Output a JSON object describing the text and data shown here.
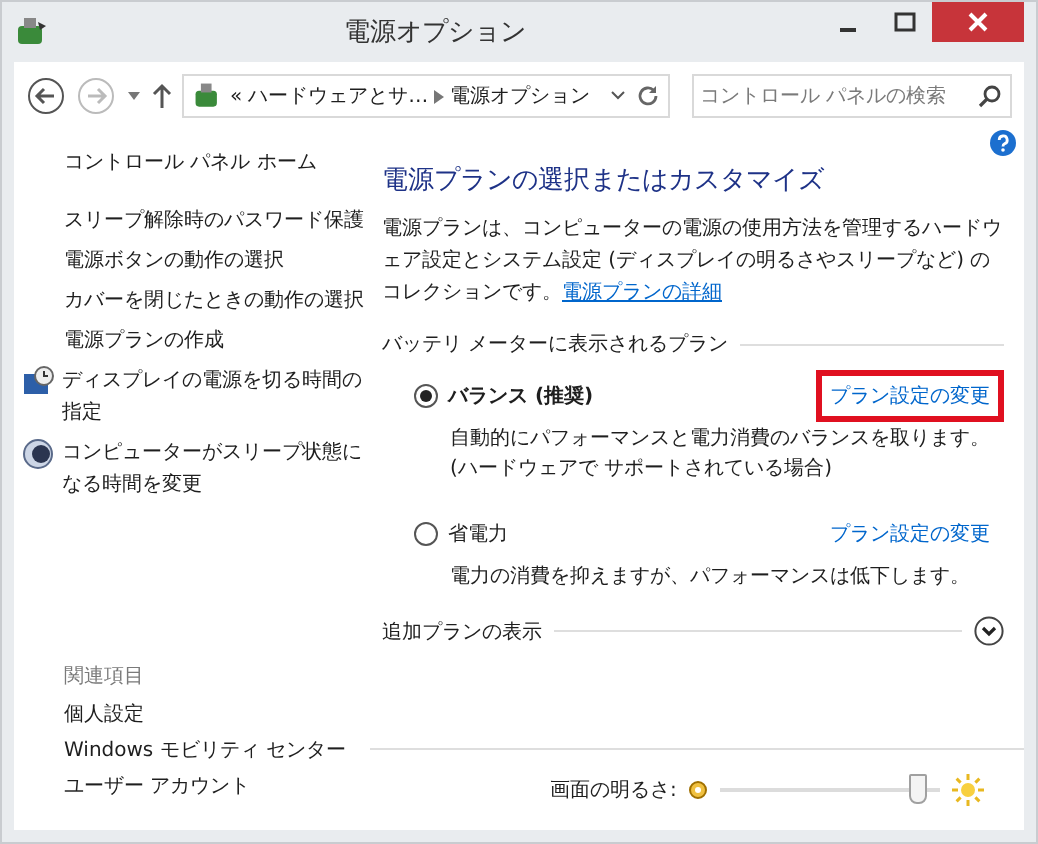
{
  "window": {
    "title": "電源オプション"
  },
  "address_bar": {
    "overflow": "«",
    "crumbs": [
      "ハードウェアとサ…",
      "電源オプション"
    ]
  },
  "search": {
    "placeholder": "コントロール パネルの検索"
  },
  "sidebar": {
    "home": "コントロール パネル ホーム",
    "items": [
      {
        "label": "スリープ解除時のパスワード保護",
        "kind": "plain"
      },
      {
        "label": "電源ボタンの動作の選択",
        "kind": "plain"
      },
      {
        "label": "カバーを閉じたときの動作の選択",
        "kind": "plain"
      },
      {
        "label": "電源プランの作成",
        "kind": "plain"
      },
      {
        "label": "ディスプレイの電源を切る時間の指定",
        "kind": "display"
      },
      {
        "label": "コンピューターがスリープ状態になる時間を変更",
        "kind": "sleep"
      }
    ],
    "related_heading": "関連項目",
    "related": [
      "個人設定",
      "Windows モビリティ センター",
      "ユーザー アカウント"
    ]
  },
  "main": {
    "heading": "電源プランの選択またはカスタマイズ",
    "intro": "電源プランは、コンピューターの電源の使用方法を管理するハードウェア設定とシステム設定 (ディスプレイの明るさやスリープなど) のコレクションです。",
    "intro_link": "電源プランの詳細",
    "group_label": "バッテリ メーターに表示されるプラン",
    "plans": [
      {
        "name": "バランス (推奨)",
        "selected": true,
        "link": "プラン設定の変更",
        "highlighted": true,
        "description": "自動的にパフォーマンスと電力消費のバランスを取ります。(ハードウェアで サポートされている場合)"
      },
      {
        "name": "省電力",
        "selected": false,
        "link": "プラン設定の変更",
        "highlighted": false,
        "description": "電力の消費を抑えますが、パフォーマンスは低下します。"
      }
    ],
    "more_plans": "追加プランの表示"
  },
  "brightness": {
    "label": "画面の明るさ:",
    "level": 0.9
  }
}
